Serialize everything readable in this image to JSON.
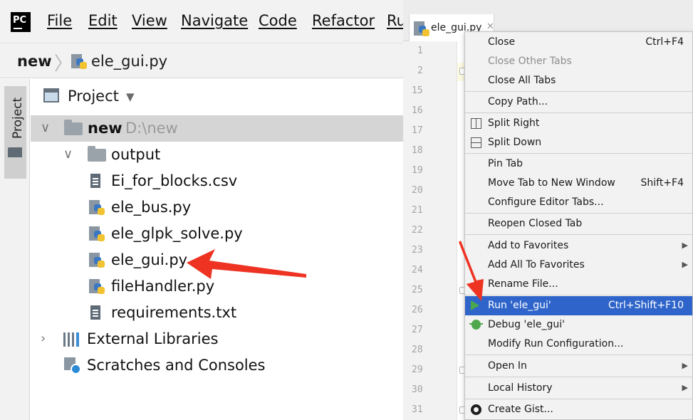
{
  "menubar": {
    "logo": "PC",
    "items": [
      "File",
      "Edit",
      "View",
      "Navigate",
      "Code",
      "Refactor",
      "Ru"
    ]
  },
  "breadcrumb": {
    "root": "new",
    "file": "ele_gui.py"
  },
  "toolstrip": {
    "label": "Project"
  },
  "project_panel": {
    "title": "Project"
  },
  "tree": {
    "root": {
      "name": "new",
      "path": "D:\\new"
    },
    "output": "output",
    "files": [
      "Ei_for_blocks.csv",
      "ele_bus.py",
      "ele_glpk_solve.py",
      "ele_gui.py",
      "fileHandler.py",
      "requirements.txt"
    ],
    "external_libraries": "External Libraries",
    "scratches": "Scratches and Consoles"
  },
  "editor": {
    "tab_label": "ele_gui.py",
    "line_numbers": [
      "1",
      "2",
      "15",
      "16",
      "17",
      "18",
      "19",
      "20",
      "21",
      "22",
      "23",
      "24",
      "25",
      "26",
      "27",
      "28",
      "29",
      "30",
      "31"
    ]
  },
  "context_menu": {
    "items": [
      {
        "label": "Close",
        "shortcut": "Ctrl+F4"
      },
      {
        "label": "Close Other Tabs"
      },
      {
        "label": "Close All Tabs"
      },
      {
        "label": "Copy Path..."
      },
      {
        "label": "Split Right"
      },
      {
        "label": "Split Down"
      },
      {
        "label": "Pin Tab"
      },
      {
        "label": "Move Tab to New Window",
        "shortcut": "Shift+F4"
      },
      {
        "label": "Configure Editor Tabs..."
      },
      {
        "label": "Reopen Closed Tab"
      },
      {
        "label": "Add to Favorites"
      },
      {
        "label": "Add All To Favorites"
      },
      {
        "label": "Rename File..."
      },
      {
        "label": "Run 'ele_gui'",
        "shortcut": "Ctrl+Shift+F10"
      },
      {
        "label": "Debug 'ele_gui'"
      },
      {
        "label": "Modify Run Configuration..."
      },
      {
        "label": "Open In"
      },
      {
        "label": "Local History"
      },
      {
        "label": "Create Gist..."
      }
    ]
  },
  "colors": {
    "annotation_arrow": "#ee3322",
    "menu_highlight": "#2f65ca",
    "run_icon": "#49a74c"
  }
}
